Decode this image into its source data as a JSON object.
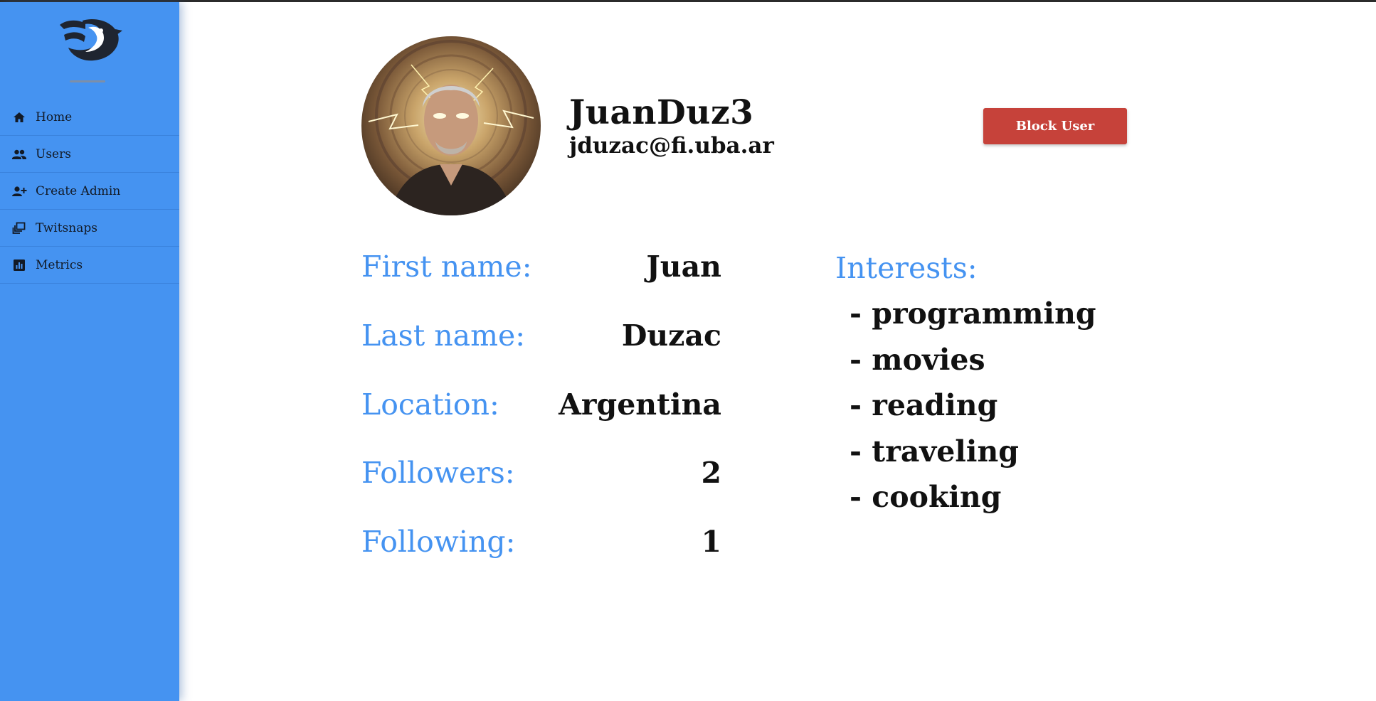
{
  "sidebar": {
    "logo_icon": "bird-logo-icon",
    "items": [
      {
        "label": "Home",
        "icon": "home-icon"
      },
      {
        "label": "Users",
        "icon": "users-icon"
      },
      {
        "label": "Create Admin",
        "icon": "add-user-icon"
      },
      {
        "label": "Twitsnaps",
        "icon": "collection-icon"
      },
      {
        "label": "Metrics",
        "icon": "chart-icon"
      }
    ]
  },
  "profile": {
    "username": "JuanDuz3",
    "email": "jduzac@fi.uba.ar",
    "block_button_label": "Block User",
    "fields": [
      {
        "label": "First name:",
        "value": "Juan"
      },
      {
        "label": "Last name:",
        "value": "Duzac"
      },
      {
        "label": "Location:",
        "value": "Argentina"
      },
      {
        "label": "Followers:",
        "value": "2"
      },
      {
        "label": "Following:",
        "value": "1"
      }
    ],
    "interests_title": "Interests:",
    "interests": [
      "- programming",
      "- movies",
      "- reading",
      "- traveling",
      "- cooking"
    ]
  },
  "colors": {
    "sidebar_bg": "#4593f1",
    "accent_label": "#4593f1",
    "block_button": "#c6423a",
    "text": "#111111"
  }
}
